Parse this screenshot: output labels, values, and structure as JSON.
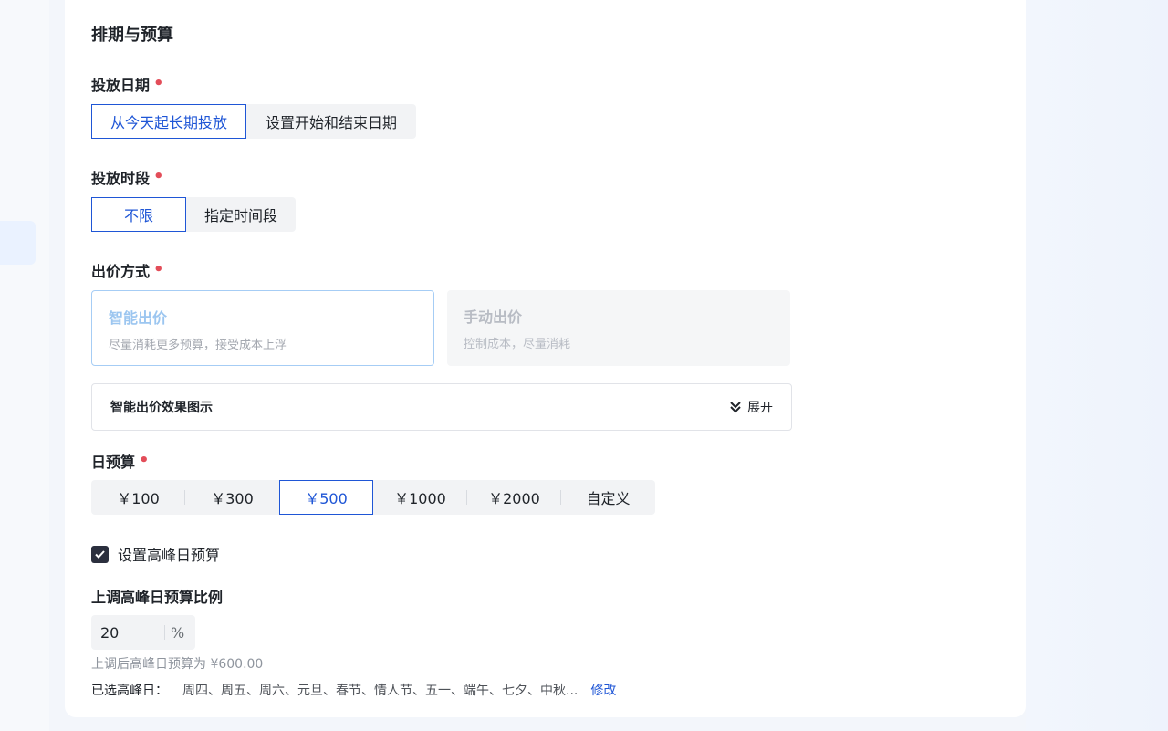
{
  "section_title": "排期与预算",
  "required_mark": "•",
  "delivery_date": {
    "label": "投放日期",
    "options": [
      "从今天起长期投放",
      "设置开始和结束日期"
    ],
    "selected": "从今天起长期投放"
  },
  "delivery_period": {
    "label": "投放时段",
    "options": [
      "不限",
      "指定时间段"
    ],
    "selected": "不限"
  },
  "bidding": {
    "label": "出价方式",
    "smart": {
      "title": "智能出价",
      "desc": "尽量消耗更多预算，接受成本上浮"
    },
    "manual": {
      "title": "手动出价",
      "desc": "控制成本，尽量消耗"
    },
    "effect_title": "智能出价效果图示",
    "expand_label": "展开"
  },
  "daily_budget": {
    "label": "日预算",
    "options": [
      "￥100",
      "￥300",
      "￥500",
      "￥1000",
      "￥2000",
      "自定义"
    ],
    "selected": "￥500"
  },
  "peak": {
    "checkbox_label": "设置高峰日预算",
    "checked": true,
    "ratio_label": "上调高峰日预算比例",
    "ratio_value": "20",
    "ratio_unit": "%",
    "hint": "上调后高峰日预算为 ¥600.00",
    "selected_label": "已选高峰日：",
    "selected_days": "周四、周五、周六、元旦、春节、情人节、五一、端午、七夕、中秋...",
    "edit_label": "修改"
  },
  "colors": {
    "accent": "#1f56d6",
    "required": "#e34d59",
    "checkbox": "#2b2f3e"
  }
}
